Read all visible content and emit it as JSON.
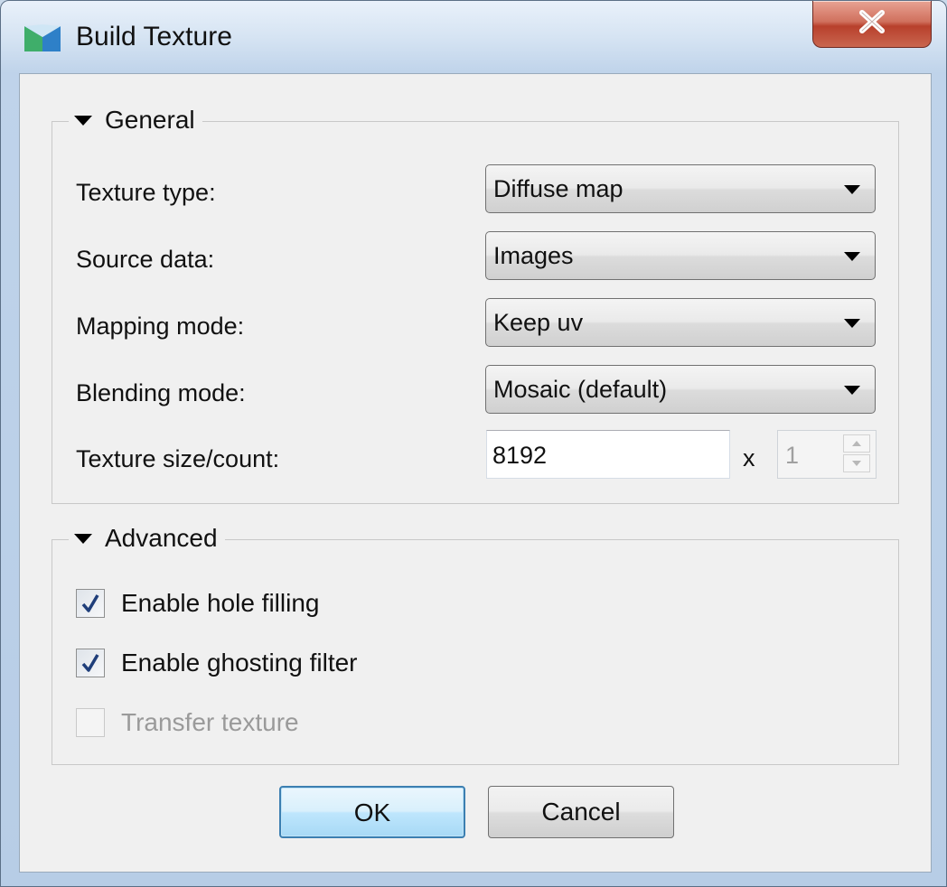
{
  "window": {
    "title": "Build Texture",
    "close_glyph": "X"
  },
  "general": {
    "title": "General",
    "rows": [
      {
        "label": "Texture type:",
        "value": "Diffuse map"
      },
      {
        "label": "Source data:",
        "value": "Images"
      },
      {
        "label": "Mapping mode:",
        "value": "Keep uv"
      },
      {
        "label": "Blending mode:",
        "value": "Mosaic (default)"
      }
    ],
    "size_label": "Texture size/count:",
    "size_value": "8192",
    "times": "x",
    "count_value": "1"
  },
  "advanced": {
    "title": "Advanced",
    "checks": [
      {
        "label": "Enable hole filling",
        "checked": true,
        "enabled": true
      },
      {
        "label": "Enable ghosting filter",
        "checked": true,
        "enabled": true
      },
      {
        "label": "Transfer texture",
        "checked": false,
        "enabled": false
      }
    ]
  },
  "buttons": {
    "ok": "OK",
    "cancel": "Cancel"
  },
  "icons": {
    "app": "app-icon",
    "close": "close-icon",
    "expand": "triangle-down-icon",
    "dropdown": "chevron-down-icon",
    "check": "checkmark-icon"
  },
  "colors": {
    "titlebar": "#d6e4f3",
    "client_bg": "#f0f0f0",
    "close_red": "#c9503b",
    "default_button": "#3c7fb1"
  }
}
